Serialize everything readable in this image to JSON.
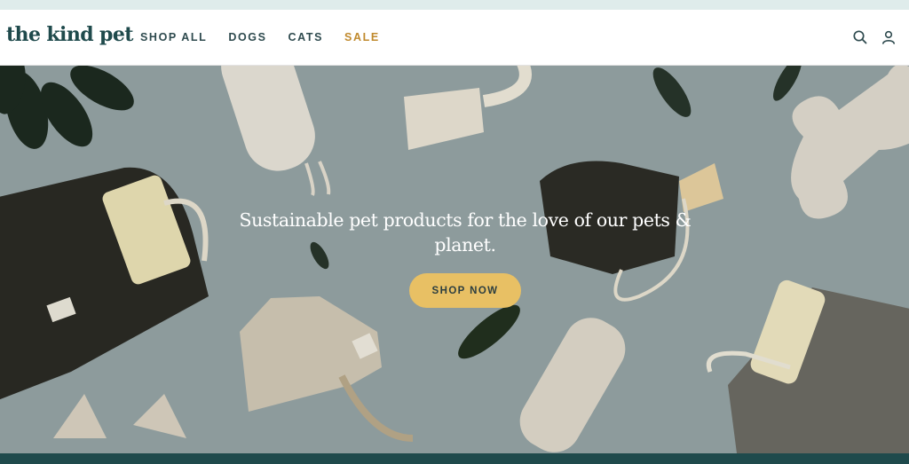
{
  "announcement": {
    "color": "#dfeceb"
  },
  "header": {
    "logo": "the kind pet",
    "nav": [
      {
        "label": "SHOP ALL"
      },
      {
        "label": "DOGS"
      },
      {
        "label": "CATS"
      },
      {
        "label": "SALE"
      }
    ],
    "icons": [
      "search-icon",
      "account-icon"
    ]
  },
  "hero": {
    "heading": "Sustainable pet products for the love of our pets & planet.",
    "cta": "SHOP NOW",
    "background_color": "#93a2a3",
    "cta_color": "#e8c064"
  },
  "colors": {
    "brand": "#1f4a4c",
    "sale": "#c08a2e"
  }
}
